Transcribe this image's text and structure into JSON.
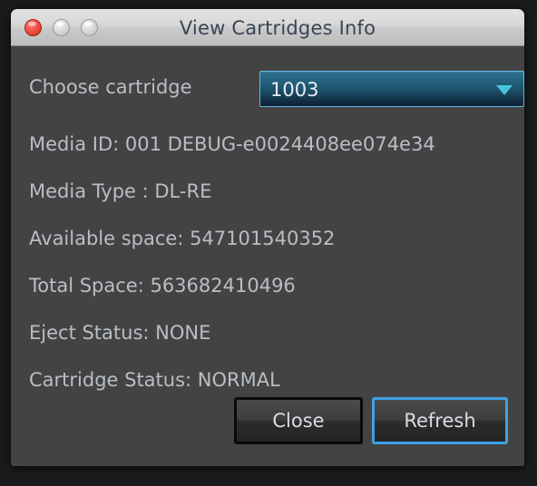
{
  "window": {
    "title": "View Cartridges Info",
    "traffic_lights": [
      {
        "name": "close",
        "color": "#ec4a3c"
      },
      {
        "name": "minimize",
        "color": "#d6d6d6"
      },
      {
        "name": "maximize",
        "color": "#d6d6d6"
      }
    ]
  },
  "chooser": {
    "label": "Choose cartridge",
    "selected": "1003",
    "arrow_icon": "chevron-down-icon",
    "accent_color": "#49c4e0",
    "border_color": "#63b6df"
  },
  "info": [
    "Media ID: 001 DEBUG-e0024408ee074e34",
    "Media Type : DL-RE",
    "Available space: 547101540352",
    "Total Space: 563682410496",
    "Eject Status: NONE",
    "Cartridge Status: NORMAL"
  ],
  "info_fields": {
    "media_id": "001 DEBUG-e0024408ee074e34",
    "media_type": "DL-RE",
    "available_space": "547101540352",
    "total_space": "563682410496",
    "eject_status": "NONE",
    "cartridge_status": "NORMAL"
  },
  "buttons": {
    "close": "Close",
    "refresh": "Refresh",
    "focus_color": "#3ea1e8"
  }
}
